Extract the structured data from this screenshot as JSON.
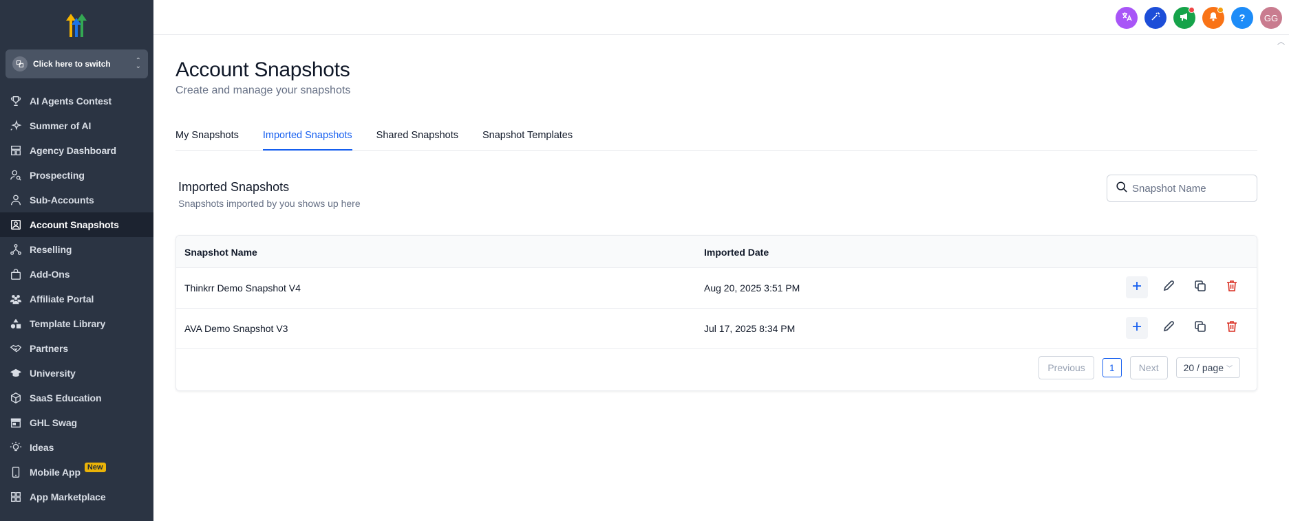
{
  "sidebar": {
    "switcher_label": "Click here to switch",
    "items": [
      {
        "label": "AI Agents Contest",
        "icon": "trophy-icon",
        "active": false
      },
      {
        "label": "Summer of AI",
        "icon": "sparkle-icon",
        "active": false
      },
      {
        "label": "Agency Dashboard",
        "icon": "dashboard-icon",
        "active": false
      },
      {
        "label": "Prospecting",
        "icon": "user-search-icon",
        "active": false
      },
      {
        "label": "Sub-Accounts",
        "icon": "user-icon",
        "active": false
      },
      {
        "label": "Account Snapshots",
        "icon": "snapshot-icon",
        "active": true
      },
      {
        "label": "Reselling",
        "icon": "reselling-icon",
        "active": false
      },
      {
        "label": "Add-Ons",
        "icon": "bag-icon",
        "active": false
      },
      {
        "label": "Affiliate Portal",
        "icon": "users-icon",
        "active": false
      },
      {
        "label": "Template Library",
        "icon": "shapes-icon",
        "active": false
      },
      {
        "label": "Partners",
        "icon": "handshake-icon",
        "active": false
      },
      {
        "label": "University",
        "icon": "graduation-cap-icon",
        "active": false
      },
      {
        "label": "SaaS Education",
        "icon": "cube-icon",
        "active": false
      },
      {
        "label": "GHL Swag",
        "icon": "store-icon",
        "active": false
      },
      {
        "label": "Ideas",
        "icon": "lightbulb-icon",
        "active": false
      },
      {
        "label": "Mobile App",
        "icon": "mobile-icon",
        "active": false,
        "badge": "New"
      },
      {
        "label": "App Marketplace",
        "icon": "grid-icon",
        "active": false
      }
    ]
  },
  "topbar": {
    "avatar_initials": "GG",
    "help_label": "?",
    "colors": {
      "translate": "#a855f7",
      "magic": "#1d4ed8",
      "announce": "#16a34a",
      "bell": "#f97316",
      "help": "#1d8cf8",
      "avatar": "#c97c8f"
    }
  },
  "main": {
    "title": "Account Snapshots",
    "subtitle": "Create and manage your snapshots",
    "tabs": [
      {
        "label": "My Snapshots",
        "active": false
      },
      {
        "label": "Imported Snapshots",
        "active": true
      },
      {
        "label": "Shared Snapshots",
        "active": false
      },
      {
        "label": "Snapshot Templates",
        "active": false
      }
    ],
    "section_title": "Imported Snapshots",
    "section_subtitle": "Snapshots imported by you shows up here",
    "search_placeholder": "Snapshot Name",
    "table": {
      "columns": [
        "Snapshot Name",
        "Imported Date"
      ],
      "rows": [
        {
          "name": "Thinkrr Demo Snapshot V4",
          "date": "Aug 20, 2025 3:51 PM"
        },
        {
          "name": "AVA Demo Snapshot V3",
          "date": "Jul 17, 2025 8:34 PM"
        }
      ]
    },
    "pagination": {
      "previous": "Previous",
      "current": "1",
      "next": "Next",
      "page_size": "20 / page"
    }
  },
  "colors": {
    "accent": "#155eef",
    "sidebar_bg": "#2b3443",
    "delete": "#d92d20"
  }
}
